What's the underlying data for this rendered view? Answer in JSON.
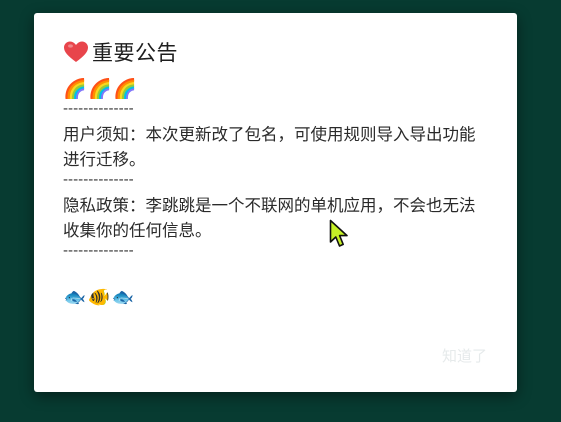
{
  "dialog": {
    "title_emoji": "❤️",
    "title": "重要公告",
    "rainbows": [
      "🌈",
      "🌈",
      "🌈"
    ],
    "separator": "--------------",
    "notice": "用户须知：本次更新改了包名，可使用规则导入导出功能进行迁移。",
    "privacy": "隐私政策：李跳跳是一个不联网的单机应用，不会也无法收集你的任何信息。",
    "fish": [
      "🐟",
      "🐠",
      "🐟"
    ],
    "ok_label": "知道了"
  },
  "colors": {
    "backdrop": "#073b31",
    "dialog_bg": "#ffffff",
    "heart": "#e8454b",
    "button_text": "#e6eaeb",
    "cursor": "#c6f026"
  }
}
